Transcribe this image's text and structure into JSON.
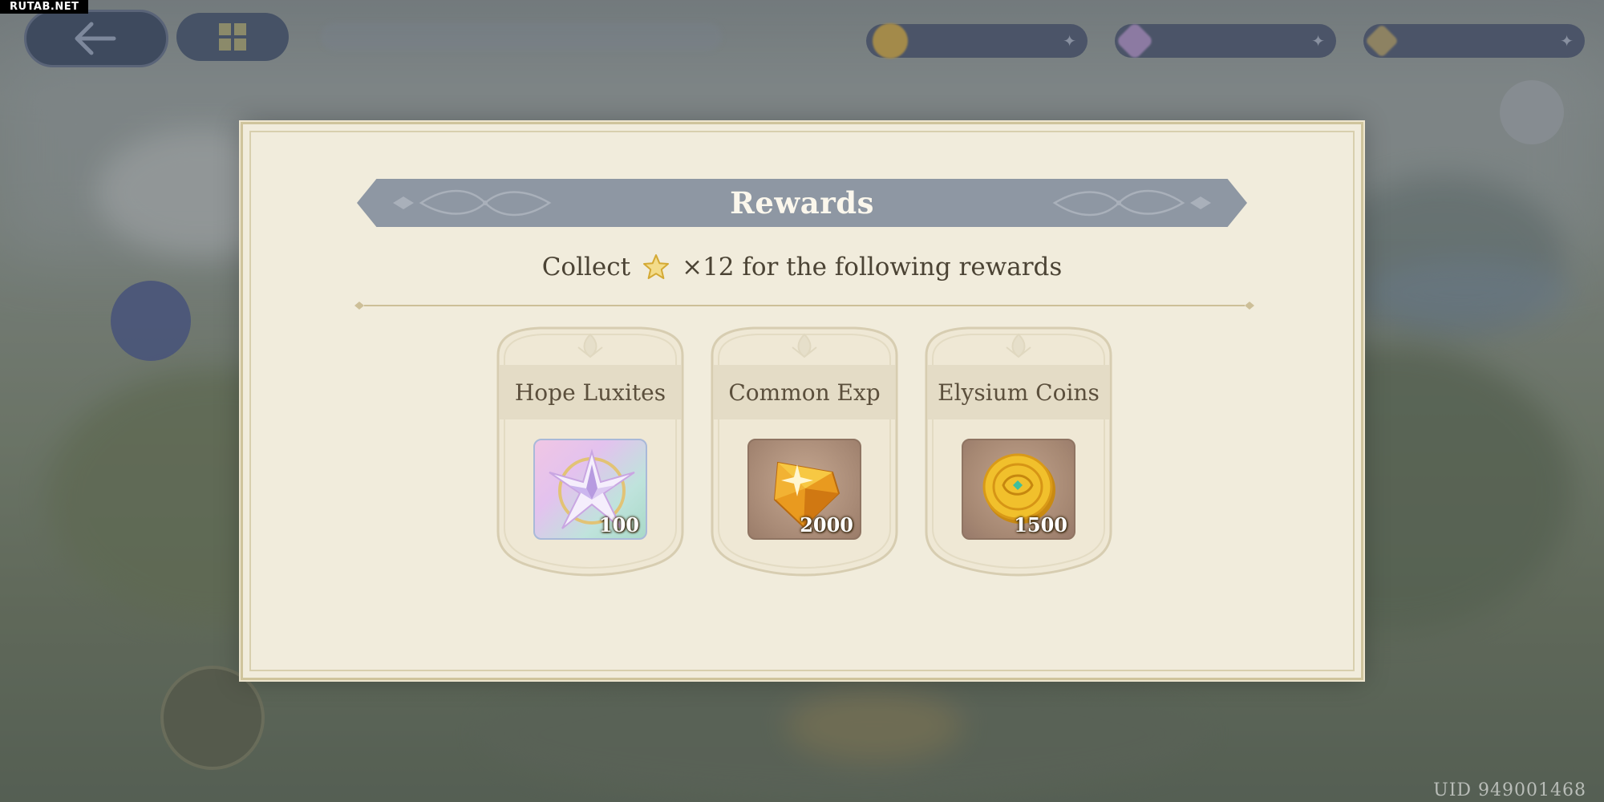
{
  "watermark": "RUTAB.NET",
  "uid": "UID 949001468",
  "modal": {
    "title": "Rewards",
    "subtitle_prefix": "Collect",
    "subtitle_suffix": "×12 for the following rewards",
    "star_icon": "star-icon",
    "rewards": [
      {
        "name": "Hope Luxites",
        "quantity": "100",
        "icon": "crystal-star-icon"
      },
      {
        "name": "Common Exp",
        "quantity": "2000",
        "icon": "amber-gem-icon"
      },
      {
        "name": "Elysium Coins",
        "quantity": "1500",
        "icon": "gold-coin-icon"
      }
    ]
  },
  "colors": {
    "panel": "#f1ecdc",
    "banner": "#8e97a3",
    "text": "#4b4334",
    "gold_star": "#e6c14a"
  }
}
